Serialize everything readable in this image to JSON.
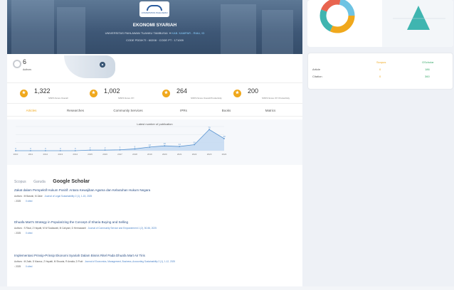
{
  "banner": {
    "logo_text": "UNIVERSITAS PAHLAWAN",
    "title": "EKONOMI SYARIAH",
    "institution": "UNIVERSITAS PAHLAWAN TUANKU TAMBUSAI",
    "location": "KAB. KAMPAR - RIAU, ID",
    "codes": "CODE PDDIKTI : 60208  ·  CODE PT : 171009"
  },
  "authors": {
    "count": "6",
    "label": "Authors"
  },
  "stats": [
    {
      "icon": "award-icon",
      "value": "1,322",
      "label": "SINTA Score Overall"
    },
    {
      "icon": "award-icon",
      "value": "1,002",
      "label": "SINTA Score 3Yr"
    },
    {
      "icon": "award-icon",
      "value": "264",
      "label": "SINTA Score Overall Productivity"
    },
    {
      "icon": "award-icon",
      "value": "200",
      "label": "SINTA Score 3Yr Productivity"
    }
  ],
  "tabs": [
    "Articles",
    "Researches",
    "Community Services",
    "IPRs",
    "Books",
    "Matrics"
  ],
  "chart_data": {
    "type": "area",
    "title": "Latest number of publication",
    "x": [
      "2010",
      "2011",
      "2012",
      "2013",
      "2014",
      "2015",
      "2016",
      "2017",
      "2018",
      "2019",
      "2020",
      "2021",
      "2022",
      "2023",
      "2024"
    ],
    "values": [
      0,
      0,
      0,
      0,
      0,
      2,
      2,
      3,
      6,
      12,
      16,
      14,
      20,
      70,
      40
    ],
    "ylim": [
      0,
      80
    ]
  },
  "sources": [
    "Scopus",
    "Garuda",
    "Google Scholar"
  ],
  "publications": [
    {
      "title": "Zakat dalam Perspektif Hukum Positif: Antara Kewajiban Agama dan Kebutuhan Hukum Negara",
      "authors": "Authors : M Basrah, M Zakir",
      "journal": "Journal of Legal Sustainability 2 (1), 1-15, 2025",
      "year": "2025",
      "cited": "0 cited"
    },
    {
      "title": "Dhuafa Mart's Strategy in Popularizing the Concept of Sharia Buying and Selling",
      "authors": "Authors : S Rizal, Z Hayatti, M W Susilawati, M Cahyani, D Hermawanti",
      "journal": "Journal of Community Service and Empowerment 1 (2), 50-56, 2025",
      "year": "2025",
      "cited": "0 cited"
    },
    {
      "title": "Implementasi Prinsip-Prinsip Ekonomi Syariah Dalam Bisnis Ritel Pada Dhuafa Mart Air Tiris",
      "authors": "Authors : M Zakir, D Marzuz, Z Hayatti, M Shuaria, R Amalia, D Putri",
      "journal": "Journal of Economics, Management, Business, Accounting Sustainability 2 (1), 1-12, 2025",
      "year": "2025",
      "cited": "0 cited"
    }
  ],
  "side_table": {
    "headers": [
      "Scopus",
      "GScholar"
    ],
    "rows": [
      {
        "label": "Article",
        "scopus": "0",
        "gscholar": "186"
      },
      {
        "label": "Citation",
        "scopus": "0",
        "gscholar": "360"
      }
    ]
  },
  "colors": {
    "accent": "#f0a81c",
    "link": "#2b4f86",
    "teal": "#3fb5b0"
  }
}
